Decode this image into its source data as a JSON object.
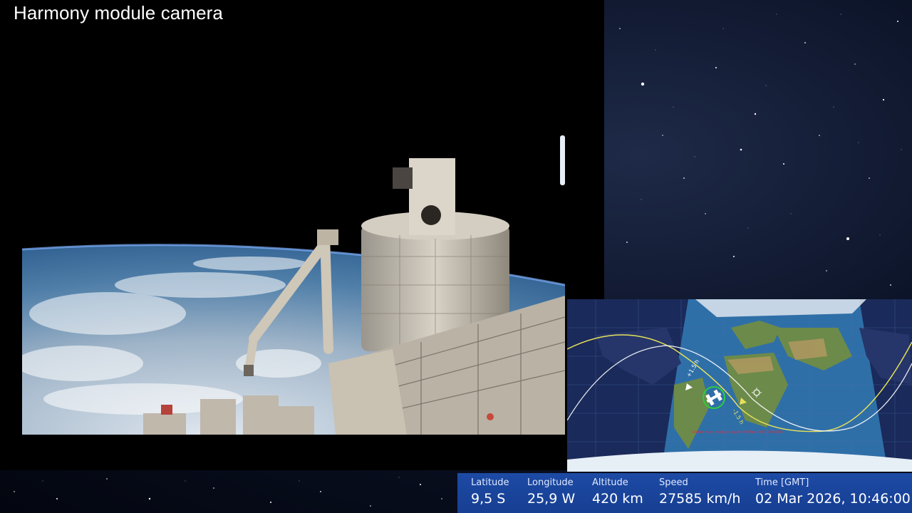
{
  "stream": {
    "title": "Harmony module camera"
  },
  "map": {
    "orbit_marker_ahead": "+1.5 h",
    "orbit_marker_behind": "-1.5 h",
    "caption": "Visited more modules again 02 Mar 2026 10:46:00"
  },
  "telemetry": {
    "latitude_label": "Latitude",
    "latitude_value": "9,5 S",
    "longitude_label": "Longitude",
    "longitude_value": "25,9 W",
    "altitude_label": "Altitude",
    "altitude_value": "420 km",
    "speed_label": "Speed",
    "speed_value": "27585 km/h",
    "time_label": "Time [GMT]",
    "time_value": "02 Mar 2026, 10:46:00"
  },
  "colors": {
    "info_bar": "#1d4aa5",
    "ground_track_current": "#e6e05a",
    "ground_track_next": "#ffffff",
    "iss_marker": "#2ecc40",
    "map_caption": "#e03040"
  },
  "icons": [
    "sun-icon",
    "iss-icon"
  ]
}
